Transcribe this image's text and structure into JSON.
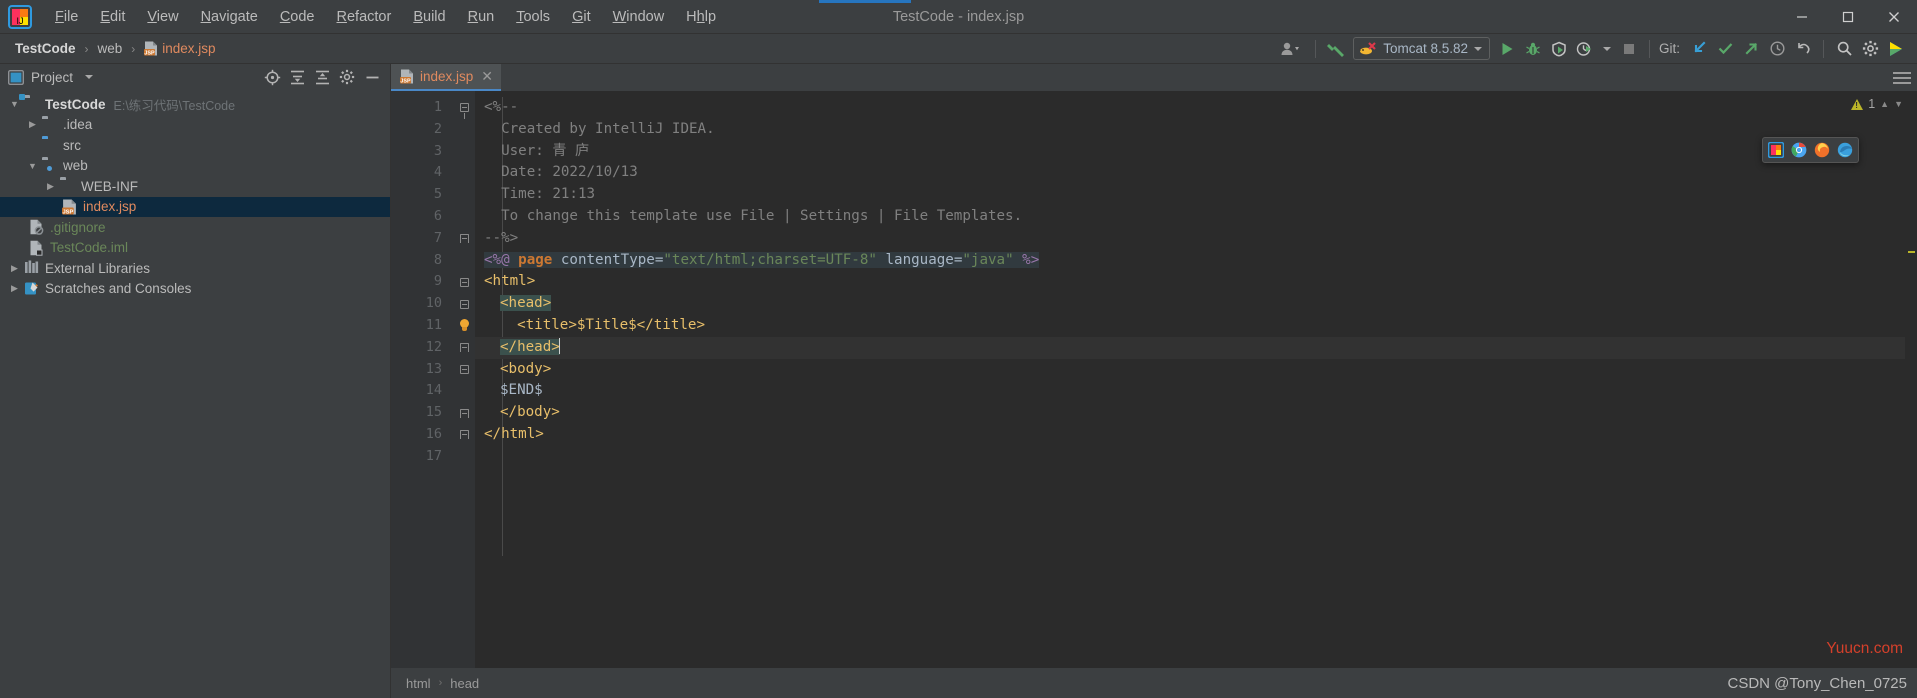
{
  "window": {
    "title": "TestCode - index.jsp",
    "minimize_label": "—",
    "maximize_label": "❐",
    "close_label": "✕"
  },
  "menubar": {
    "logo_name": "intellij-idea-logo",
    "items": [
      {
        "label": "File",
        "mnemonic": "F"
      },
      {
        "label": "Edit",
        "mnemonic": "E"
      },
      {
        "label": "View",
        "mnemonic": "V"
      },
      {
        "label": "Navigate",
        "mnemonic": "N"
      },
      {
        "label": "Code",
        "mnemonic": "C"
      },
      {
        "label": "Refactor",
        "mnemonic": "R"
      },
      {
        "label": "Build",
        "mnemonic": "B"
      },
      {
        "label": "Run",
        "mnemonic": "R"
      },
      {
        "label": "Tools",
        "mnemonic": "T"
      },
      {
        "label": "Git",
        "mnemonic": "G"
      },
      {
        "label": "Window",
        "mnemonic": "W"
      },
      {
        "label": "Help",
        "mnemonic": "H"
      }
    ]
  },
  "navbar": {
    "breadcrumbs": [
      {
        "label": "TestCode",
        "kind": "project"
      },
      {
        "label": "web",
        "kind": "folder"
      },
      {
        "label": "index.jsp",
        "kind": "jsp-file"
      }
    ],
    "separator": "›",
    "run_config": {
      "label": "Tomcat 8.5.82",
      "icon": "tomcat-cat-icon"
    },
    "git_label": "Git:",
    "buttons": [
      {
        "name": "user-account-button",
        "icon": "person-icon"
      },
      {
        "name": "build-project-button",
        "icon": "hammer-icon"
      },
      {
        "name": "run-button",
        "icon": "run-triangle-icon"
      },
      {
        "name": "debug-button",
        "icon": "debug-bug-icon"
      },
      {
        "name": "run-coverage-button",
        "icon": "coverage-shield-icon"
      },
      {
        "name": "profiler-button",
        "icon": "profiler-clock-icon"
      },
      {
        "name": "stop-button",
        "icon": "stop-square-icon"
      },
      {
        "name": "git-update-button",
        "icon": "update-arrow-down-icon"
      },
      {
        "name": "git-commit-button",
        "icon": "commit-check-icon"
      },
      {
        "name": "git-push-button",
        "icon": "push-arrow-up-icon"
      },
      {
        "name": "git-history-button",
        "icon": "history-clock-icon"
      },
      {
        "name": "git-rollback-button",
        "icon": "rollback-undo-icon"
      },
      {
        "name": "search-everywhere-button",
        "icon": "search-icon"
      },
      {
        "name": "settings-button",
        "icon": "gear-icon"
      },
      {
        "name": "ide-assistant-button",
        "icon": "colorful-play-icon"
      }
    ]
  },
  "sidebar": {
    "title": "Project",
    "dropdown_icon": "chevron-down-icon",
    "header_buttons": [
      {
        "name": "select-opened-file-button",
        "icon": "crosshair-target-icon"
      },
      {
        "name": "expand-all-button",
        "icon": "expand-all-icon"
      },
      {
        "name": "collapse-all-button",
        "icon": "collapse-all-icon"
      },
      {
        "name": "tool-settings-button",
        "icon": "gear-icon"
      },
      {
        "name": "hide-panel-button",
        "icon": "minimize-dash-icon"
      }
    ],
    "tree": [
      {
        "label": "TestCode",
        "path": "E:\\练习代码\\TestCode",
        "depth": 0,
        "arrow": "down",
        "icon": "module-folder-icon",
        "bold": true,
        "selected": false,
        "color": "default"
      },
      {
        "label": ".idea",
        "path": "",
        "depth": 1,
        "arrow": "right",
        "icon": "folder-icon",
        "bold": false,
        "selected": false,
        "color": "default"
      },
      {
        "label": "src",
        "path": "",
        "depth": 1,
        "arrow": "none",
        "icon": "source-folder-icon",
        "bold": false,
        "selected": false,
        "color": "default"
      },
      {
        "label": "web",
        "path": "",
        "depth": 1,
        "arrow": "down",
        "icon": "web-folder-icon",
        "bold": false,
        "selected": false,
        "color": "default"
      },
      {
        "label": "WEB-INF",
        "path": "",
        "depth": 2,
        "arrow": "right",
        "icon": "folder-icon",
        "bold": false,
        "selected": false,
        "color": "default"
      },
      {
        "label": "index.jsp",
        "path": "",
        "depth": 3,
        "arrow": "none",
        "icon": "jsp-file-icon",
        "bold": false,
        "selected": true,
        "color": "jsp"
      },
      {
        "label": ".gitignore",
        "path": "",
        "depth": 1,
        "arrow": "none",
        "icon": "gitignore-file-icon",
        "bold": false,
        "selected": false,
        "color": "green"
      },
      {
        "label": "TestCode.iml",
        "path": "",
        "depth": 1,
        "arrow": "none",
        "icon": "iml-file-icon",
        "bold": false,
        "selected": false,
        "color": "green"
      },
      {
        "label": "External Libraries",
        "path": "",
        "depth": 0,
        "arrow": "right",
        "icon": "library-icon",
        "bold": false,
        "selected": false,
        "color": "default"
      },
      {
        "label": "Scratches and Consoles",
        "path": "",
        "depth": 0,
        "arrow": "right",
        "icon": "scratches-icon",
        "bold": false,
        "selected": false,
        "color": "default"
      }
    ]
  },
  "editor": {
    "tab": {
      "label": "index.jsp",
      "icon": "jsp-file-icon",
      "close_label": "✕"
    },
    "options_icon": "hamburger-menu-icon",
    "inspection_widget": {
      "warning_count": "1",
      "icon": "warning-triangle-icon",
      "chevron_up": "⌃",
      "chevron_down": "⌄"
    },
    "browser_popup": {
      "icons": [
        {
          "name": "intellij-browser-icon",
          "color": "#f06292"
        },
        {
          "name": "chrome-browser-icon",
          "color": "#4aa5f0"
        },
        {
          "name": "firefox-browser-icon",
          "color": "#f0712a"
        },
        {
          "name": "edge-browser-icon",
          "color": "#3aa0dd"
        }
      ]
    },
    "lines": [
      {
        "n": "1",
        "fold": "open-start",
        "bulb": false,
        "text": "<%--"
      },
      {
        "n": "2",
        "fold": "none",
        "bulb": false,
        "text": "  Created by IntelliJ IDEA."
      },
      {
        "n": "3",
        "fold": "none",
        "bulb": false,
        "text": "  User: 青 庐"
      },
      {
        "n": "4",
        "fold": "none",
        "bulb": false,
        "text": "  Date: 2022/10/13"
      },
      {
        "n": "5",
        "fold": "none",
        "bulb": false,
        "text": "  Time: 21:13"
      },
      {
        "n": "6",
        "fold": "none",
        "bulb": false,
        "text": "  To change this template use File | Settings | File Templates."
      },
      {
        "n": "7",
        "fold": "end",
        "bulb": false,
        "text": "--%>"
      },
      {
        "n": "8",
        "fold": "none",
        "bulb": false,
        "text": "<%@ page contentType=\"text/html;charset=UTF-8\" language=\"java\" %>"
      },
      {
        "n": "9",
        "fold": "open",
        "bulb": false,
        "text": "<html>"
      },
      {
        "n": "10",
        "fold": "open",
        "bulb": false,
        "text": "<head>"
      },
      {
        "n": "11",
        "fold": "none",
        "bulb": true,
        "text": "  <title>$Title$</title>"
      },
      {
        "n": "12",
        "fold": "end",
        "bulb": false,
        "text": "</head>"
      },
      {
        "n": "13",
        "fold": "open",
        "bulb": false,
        "text": "<body>"
      },
      {
        "n": "14",
        "fold": "none",
        "bulb": false,
        "text": "$END$"
      },
      {
        "n": "15",
        "fold": "end",
        "bulb": false,
        "text": "</body>"
      },
      {
        "n": "16",
        "fold": "end",
        "bulb": false,
        "text": "</html>"
      },
      {
        "n": "17",
        "fold": "none",
        "bulb": false,
        "text": ""
      }
    ]
  },
  "statusbar": {
    "breadcrumbs": [
      "html",
      "head"
    ],
    "separator": "›"
  },
  "watermarks": {
    "site": "Yuucn.com",
    "credit": "CSDN @Tony_Chen_0725"
  },
  "colors": {
    "accent_blue": "#4a88c7",
    "selection_bg": "#0d293e",
    "editor_bg": "#2b2b2b",
    "chrome_bg": "#3c3f41",
    "tag_orange": "#e8bf6a",
    "string_green": "#6a8759",
    "jsp_orange": "#e08a5f",
    "watermark_red": "#d4402b"
  }
}
